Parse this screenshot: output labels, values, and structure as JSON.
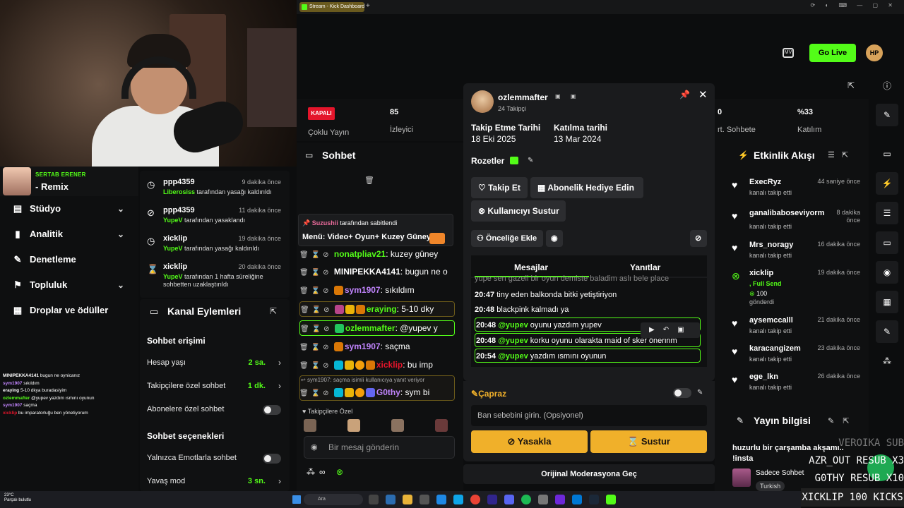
{
  "browser": {
    "tab_title": "Stream - Kick Dashboard",
    "new_tab": "+"
  },
  "header": {
    "go_live": "Go Live",
    "avatar_initials": "HP"
  },
  "profile": {
    "name": "SERTAB ERENER",
    "title": "- Remix"
  },
  "nav": [
    {
      "label": "Stüdyo",
      "icon": "studio-icon",
      "chevron": true
    },
    {
      "label": "Analitik",
      "icon": "chart-icon",
      "chevron": true
    },
    {
      "label": "Denetleme",
      "icon": "wrench-icon",
      "chevron": false
    },
    {
      "label": "Topluluk",
      "icon": "community-icon",
      "chevron": true
    },
    {
      "label": "Droplar ve ödüller",
      "icon": "gift-icon",
      "chevron": false
    }
  ],
  "overlay_chat": [
    {
      "user": "MINIPEKKA4141",
      "msg": "bugun ne oynicanız"
    },
    {
      "user": "sym1907",
      "msg": "sıkıldım"
    },
    {
      "user": "eraying",
      "msg": "5-10 dkya buradasiyim"
    },
    {
      "user": "ozlemmafter",
      "msg": "@yupev yazdım ısmını oyunun"
    },
    {
      "user": "sym1907",
      "msg": "saçma"
    },
    {
      "user": "xicklip",
      "msg": "bu imparatorluğu ben yönetiyorum"
    }
  ],
  "mod_log": [
    {
      "user": "ppp4359",
      "time": "9 dakika önce",
      "actor": "Liberosiss",
      "action": "tarafından yasağı kaldırıldı",
      "icon": "clock-icon"
    },
    {
      "user": "ppp4359",
      "time": "11 dakika önce",
      "actor": "YupeV",
      "action": "tarafından yasaklandı",
      "icon": "ban-icon"
    },
    {
      "user": "xicklip",
      "time": "19 dakika önce",
      "actor": "YupeV",
      "action": "tarafından yasağı kaldırıldı",
      "icon": "clock-icon"
    },
    {
      "user": "xicklip",
      "time": "20 dakika önce",
      "actor": "YupeV",
      "action": "tarafından 1 hafta süreliğine sohbetten uzaklaştırıldı",
      "icon": "hourglass-icon"
    }
  ],
  "channel_actions": {
    "title": "Kanal Eylemleri",
    "access_title": "Sohbet erişimi",
    "rows": [
      {
        "label": "Hesap yaşı",
        "value": "2 sa."
      },
      {
        "label": "Takipçilere özel sohbet",
        "value": "1 dk."
      },
      {
        "label": "Abonelere özel sohbet",
        "value": ""
      }
    ],
    "options_title": "Sohbet seçenekleri",
    "rows2": [
      {
        "label": "Yalnızca Emotlarla sohbet",
        "value": ""
      },
      {
        "label": "Yavaş mod",
        "value": "3 sn."
      }
    ]
  },
  "stats": {
    "status": "KAPALI",
    "multi": "Çoklu Yayın",
    "viewers": "85",
    "viewers_label": "İzleyici",
    "stat3": "0",
    "stat3_label": "rt. Sohbete",
    "pct": "%33",
    "pct_label": "Katılım"
  },
  "chat": {
    "title": "Sohbet",
    "pinned_by": "Suzushii",
    "pinned_suffix": "tarafından sabitlendi",
    "pinned_msg": "Menü: Video+ Oyun+ Kuzey Güney",
    "messages": [
      {
        "user": "nonatpliav21",
        "msg": ": kuzey güney",
        "color": "#53fc18"
      },
      {
        "user": "MINIPEKKA4141",
        "msg": ": bugun ne o",
        "color": "#ffffff"
      },
      {
        "user": "sym1907",
        "msg": ": sıkıldım",
        "color": "#c084fc"
      },
      {
        "user": "eraying",
        "msg": ": 5-10 dky",
        "color": "#53fc18"
      },
      {
        "user": "ozlemmafter",
        "msg": ": @yupev y",
        "color": "#53fc18"
      },
      {
        "user": "sym1907",
        "msg": ": saçma",
        "color": "#c084fc"
      },
      {
        "user": "xicklip",
        "msg": ": bu imp",
        "color": "#e4152b"
      },
      {
        "user": "G0thy",
        "msg": ": sym bi",
        "color": "#c084fc"
      }
    ],
    "reply_context": "sym1907: saçma isimli kullanıcıya yanıt veriyor",
    "followers_label": "Takipçilere Özel",
    "input_placeholder": "Bir mesaj gönderin"
  },
  "user_popup": {
    "username": "ozlemmafter",
    "followers": "24 Takipçi",
    "follow_date_label": "Takip Etme Tarihi",
    "follow_date": "18 Eki 2025",
    "join_date_label": "Katılma tarihi",
    "join_date": "13 Mar 2024",
    "badges_label": "Rozetler",
    "follow_btn": "Takip Et",
    "gift_btn": "Abonelik Hediye Edin",
    "mute_btn": "Kullanıcıyı Sustur",
    "priority_btn": "Önceliğe Ekle",
    "tab_messages": "Mesajlar",
    "tab_replies": "Yanıtlar",
    "messages": [
      {
        "time": "",
        "mention": "",
        "text": "yupe sen gazeli bir oyun demiste baladim aslı bele place"
      },
      {
        "time": "20:47",
        "mention": "",
        "text": "tiny eden balkonda bitki yetiştiriyon"
      },
      {
        "time": "20:48",
        "mention": "",
        "text": "blackpink kalmadı ya"
      },
      {
        "time": "20:48",
        "mention": "@yupev",
        "text": "oyunu yazdım yupev"
      },
      {
        "time": "20:48",
        "mention": "@yupev",
        "text": "korku oyunu olarakta maid of sker öneririm"
      },
      {
        "time": "20:54",
        "mention": "@yupev",
        "text": "yazdım ısmını oyunun"
      }
    ]
  },
  "capraz": {
    "title": "Çapraz",
    "reason_placeholder": "Ban sebebini girin. (Opsiyonel)",
    "ban_btn": "Yasakla",
    "mute_btn": "Sustur",
    "original_mod": "Orijinal Moderasyona Geç"
  },
  "activity": {
    "title": "Etkinlik Akışı",
    "items": [
      {
        "user": "ExecRyz",
        "sub": "kanalı takip etti",
        "time": "44 saniye önce",
        "type": "follow"
      },
      {
        "user": "ganalibaboseviyorm",
        "sub": "kanalı takip etti",
        "time": "8 dakika önce",
        "type": "follow"
      },
      {
        "user": "Mrs_noragy",
        "sub": "kanalı takip etti",
        "time": "16 dakika önce",
        "type": "follow"
      },
      {
        "user": "xicklip",
        "sub": "Full Send",
        "extra": "100",
        "extra2": "gönderdi",
        "time": "19 dakika önce",
        "type": "kicks"
      },
      {
        "user": "aysemccalll",
        "sub": "kanalı takip etti",
        "time": "21 dakika önce",
        "type": "follow"
      },
      {
        "user": "karacangizem",
        "sub": "kanalı takip etti",
        "time": "23 dakika önce",
        "type": "follow"
      },
      {
        "user": "ege_lkn",
        "sub": "kanalı takip etti",
        "time": "26 dakika önce",
        "type": "follow"
      }
    ]
  },
  "stream_info": {
    "title": "Yayın bilgisi",
    "stream_title": "huzurlu bir çarşamba akşamı.. !insta",
    "category": "Sadece Sohbet",
    "tag": "Turkish"
  },
  "sub_overlay": [
    "VEROIKA SUB",
    "AZR_OUT RESUB X3",
    "G0THY RESUB X10"
  ],
  "sub_last": "XICKLIP 100 KICKS",
  "taskbar": {
    "temp": "23°C",
    "weather": "Parçalı bulutlu",
    "search": "Ara"
  },
  "colors": {
    "kick_green": "#53fc18",
    "ban_yellow": "#f0b02a",
    "offline_red": "#e4152b"
  }
}
